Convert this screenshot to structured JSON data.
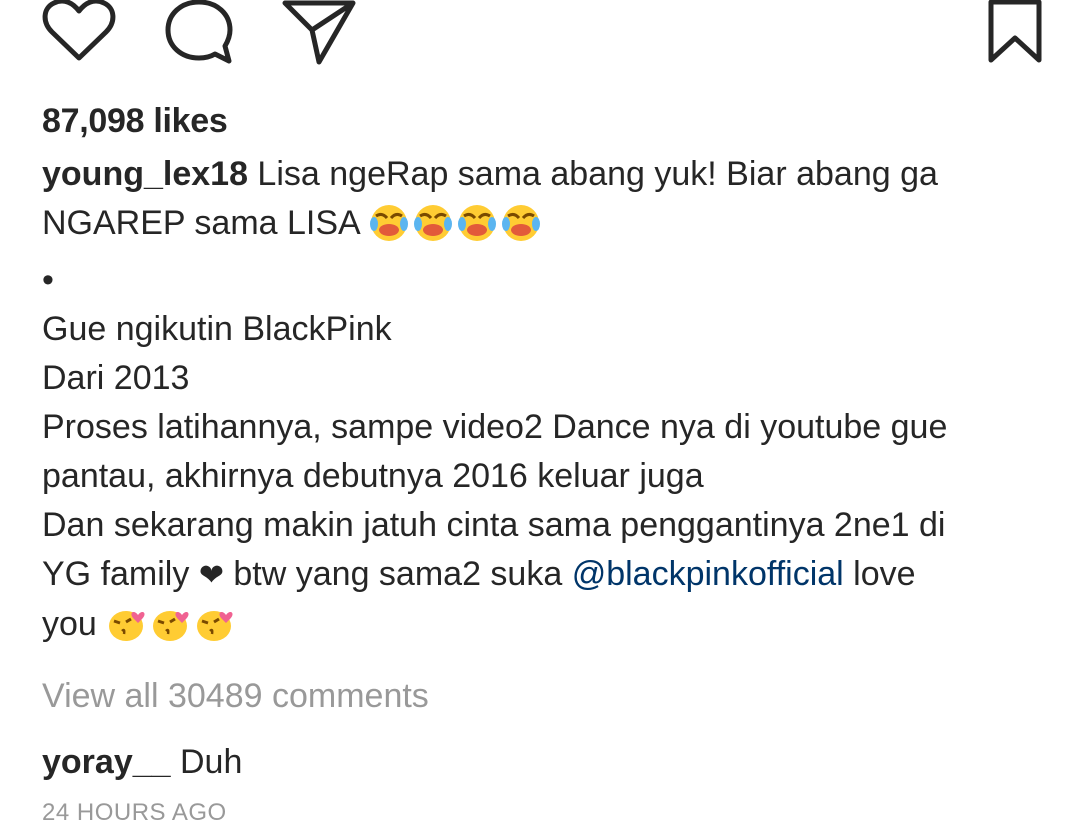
{
  "post": {
    "icons": {
      "like": "heart-icon",
      "comment": "comment-bubble-icon",
      "share": "paper-plane-icon",
      "save": "bookmark-icon"
    },
    "likes": "87,098 likes",
    "caption": {
      "username": "young_lex18",
      "line1": " Lisa ngeRap sama abang yuk! Biar abang ga",
      "line2": "NGAREP sama LISA ",
      "bullet": "•",
      "line4": "Gue ngikutin BlackPink",
      "line5": "Dari 2013",
      "line6": "Proses latihannya, sampe video2 Dance nya di youtube gue",
      "line7": "pantau, akhirnya debutnya 2016 keluar juga",
      "line8": "Dan sekarang makin jatuh cinta sama penggantinya 2ne1 di",
      "line9_a": "YG family ",
      "line9_heart": "❤",
      "line9_b": " btw yang sama2 suka ",
      "mention": "@blackpinkofficial",
      "line9_c": " love",
      "line10": "you "
    },
    "view_all": "View all 30489 comments",
    "comment": {
      "username": "yoray__",
      "text": " Duh"
    },
    "timestamp": "24 HOURS AGO",
    "colors": {
      "text": "#262626",
      "muted": "#999999",
      "mention": "#003569",
      "emoji_face": "#FFCC33",
      "emoji_heart": "#F06292"
    }
  }
}
